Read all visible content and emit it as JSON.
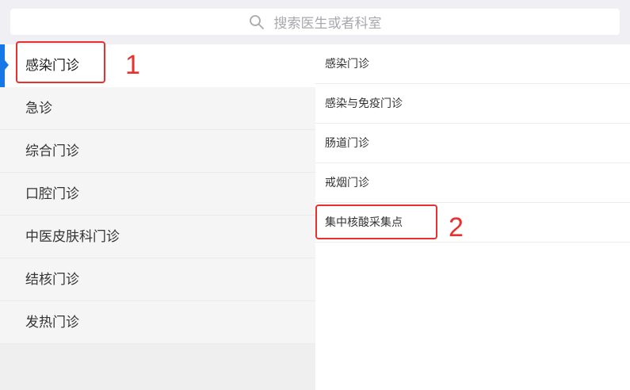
{
  "search": {
    "icon": "search-icon",
    "placeholder": "搜索医生或者科室"
  },
  "departments": [
    {
      "label": "感染门诊",
      "active": true
    },
    {
      "label": "急诊"
    },
    {
      "label": "综合门诊"
    },
    {
      "label": "口腔门诊"
    },
    {
      "label": "中医皮肤科门诊"
    },
    {
      "label": "结核门诊"
    },
    {
      "label": "发热门诊"
    }
  ],
  "sub_departments": [
    {
      "label": "感染门诊"
    },
    {
      "label": "感染与免疫门诊"
    },
    {
      "label": "肠道门诊"
    },
    {
      "label": "戒烟门诊"
    },
    {
      "label": "集中核酸采集点"
    }
  ],
  "annotations": [
    {
      "number": "1",
      "color": "#e8302e"
    },
    {
      "number": "2",
      "color": "#e8302e"
    }
  ],
  "colors": {
    "accent": "#1677e6",
    "annotation": "#e8302e"
  }
}
